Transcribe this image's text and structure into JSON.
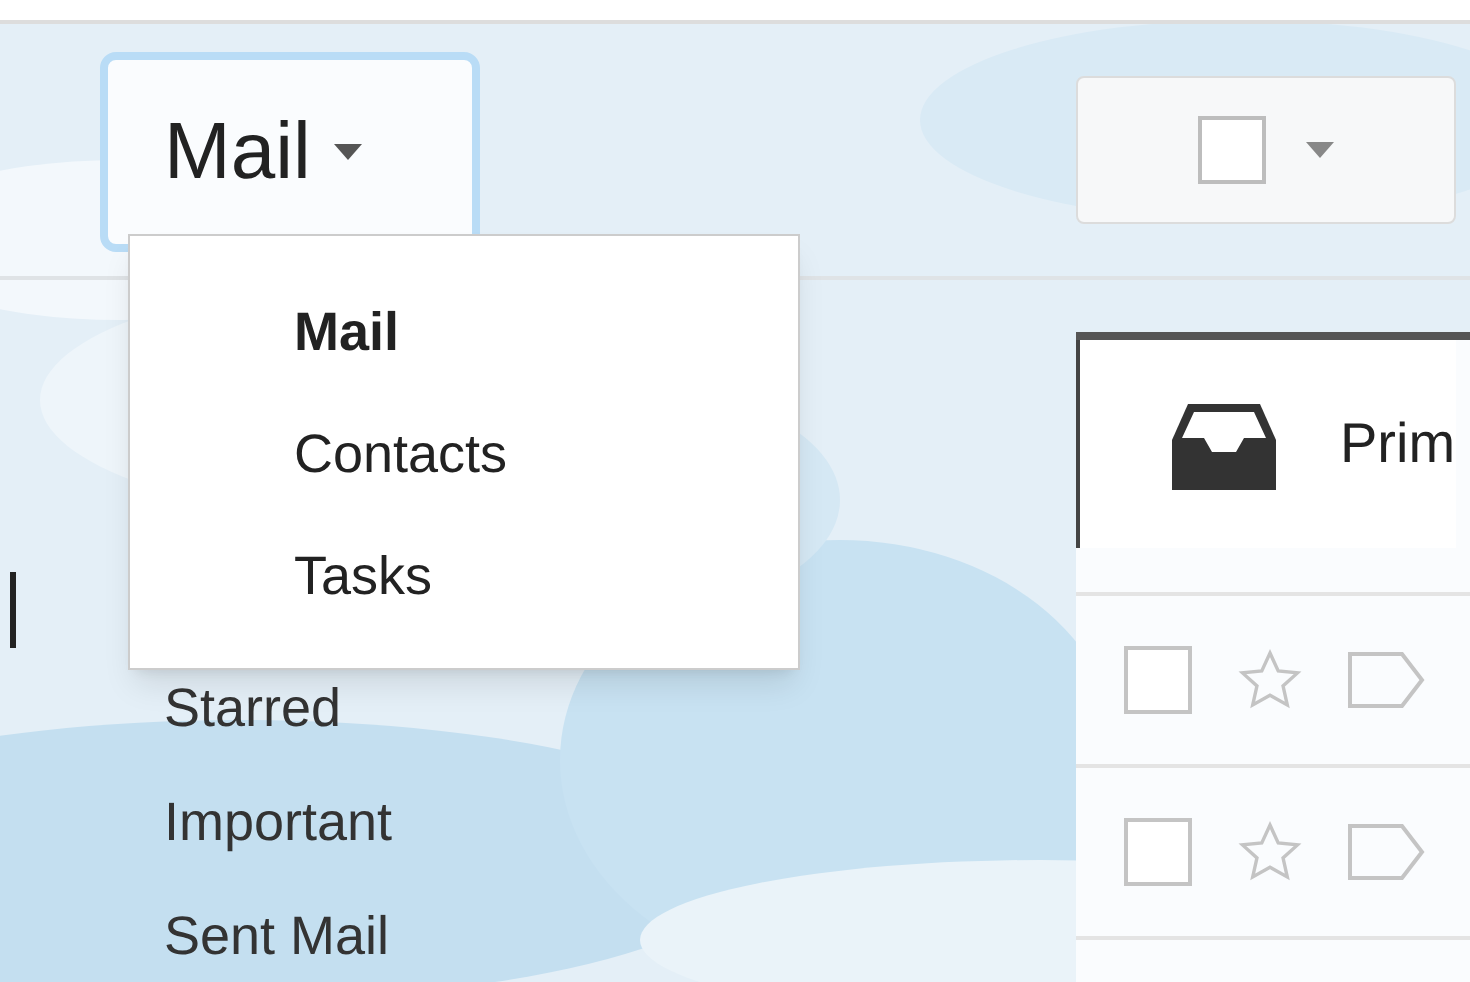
{
  "app_switcher": {
    "label": "Mail",
    "expanded": true
  },
  "app_menu": [
    {
      "label": "Mail",
      "selected": true
    },
    {
      "label": "Contacts",
      "selected": false
    },
    {
      "label": "Tasks",
      "selected": false
    }
  ],
  "sidebar_items": [
    "Starred",
    "Important",
    "Sent Mail"
  ],
  "tabs": [
    {
      "label": "Prim",
      "selected": true
    }
  ],
  "message_rows": [
    {
      "checked": false,
      "starred": false
    },
    {
      "checked": false,
      "starred": false
    }
  ]
}
